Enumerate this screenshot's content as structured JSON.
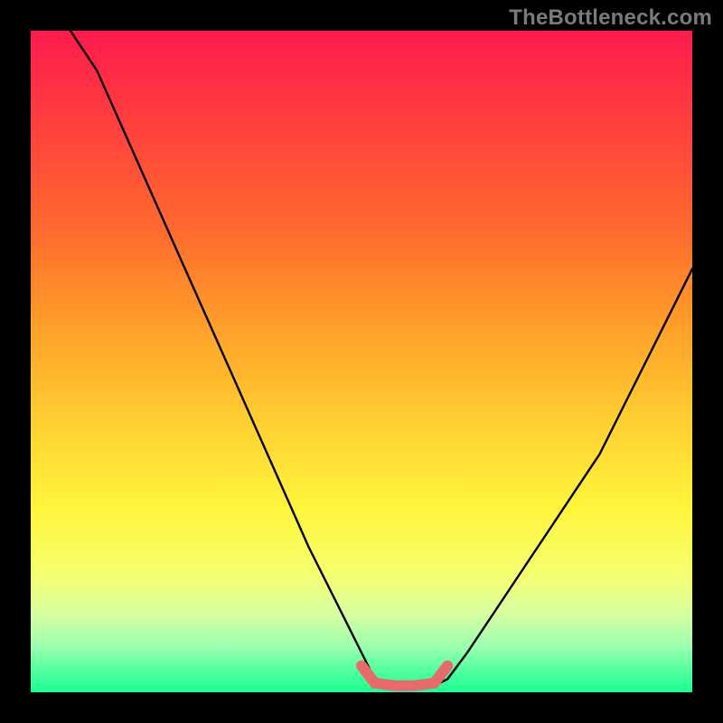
{
  "watermark": {
    "text": "TheBottleneck.com"
  },
  "chart_data": {
    "type": "line",
    "title": "",
    "xlabel": "",
    "ylabel": "",
    "xlim": [
      0,
      1
    ],
    "ylim": [
      0,
      1
    ],
    "series": [
      {
        "name": "black-curve",
        "color": "#000000",
        "x": [
          0.06,
          0.1,
          0.14,
          0.18,
          0.22,
          0.26,
          0.3,
          0.34,
          0.38,
          0.42,
          0.46,
          0.5,
          0.52,
          0.55,
          0.58,
          0.61,
          0.63,
          0.66,
          0.7,
          0.74,
          0.78,
          0.82,
          0.86,
          0.9,
          0.94,
          0.98,
          1.0
        ],
        "y": [
          1.0,
          0.94,
          0.85,
          0.76,
          0.67,
          0.58,
          0.49,
          0.4,
          0.31,
          0.22,
          0.14,
          0.06,
          0.02,
          0.01,
          0.01,
          0.01,
          0.02,
          0.06,
          0.12,
          0.18,
          0.24,
          0.3,
          0.36,
          0.44,
          0.52,
          0.6,
          0.64
        ]
      },
      {
        "name": "red-bottom-segment",
        "color": "#e86a6a",
        "x": [
          0.5,
          0.52,
          0.55,
          0.58,
          0.61,
          0.63
        ],
        "y": [
          0.04,
          0.014,
          0.01,
          0.01,
          0.014,
          0.04
        ]
      }
    ],
    "background": "rainbow-vertical"
  }
}
